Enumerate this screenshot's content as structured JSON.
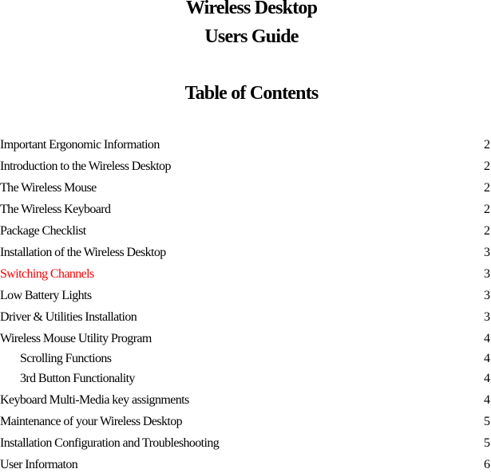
{
  "document": {
    "title_line_1": "Wireless Desktop",
    "title_line_2": "Users Guide",
    "toc_heading": "Table of Contents"
  },
  "highlight_color": "#ff0000",
  "toc": [
    {
      "label": "Important Ergonomic Information",
      "page": "2",
      "indent": false,
      "highlight": false
    },
    {
      "label": "Introduction to the Wireless Desktop",
      "page": "2",
      "indent": false,
      "highlight": false
    },
    {
      "label": "The Wireless Mouse",
      "page": "2",
      "indent": false,
      "highlight": false
    },
    {
      "label": "The Wireless Keyboard",
      "page": "2",
      "indent": false,
      "highlight": false
    },
    {
      "label": "Package Checklist",
      "page": "2",
      "indent": false,
      "highlight": false
    },
    {
      "label": "Installation of the Wireless Desktop",
      "page": "3",
      "indent": false,
      "highlight": false
    },
    {
      "label": "Switching Channels",
      "page": "3",
      "indent": false,
      "highlight": true
    },
    {
      "label": "Low Battery Lights",
      "page": "3",
      "indent": false,
      "highlight": false
    },
    {
      "label": "Driver & Utilities Installation",
      "page": "3",
      "indent": false,
      "highlight": false
    },
    {
      "label": "Wireless Mouse Utility Program",
      "page": "4",
      "indent": false,
      "highlight": false
    },
    {
      "label": "Scrolling Functions",
      "page": "4",
      "indent": true,
      "highlight": false
    },
    {
      "label": "3rd Button Functionality",
      "page": "4",
      "indent": true,
      "highlight": false
    },
    {
      "label": "Keyboard Multi-Media key assignments",
      "page": "4",
      "indent": false,
      "highlight": false
    },
    {
      "label": "Maintenance of your Wireless Desktop",
      "page": "5",
      "indent": false,
      "highlight": false
    },
    {
      "label": "Installation Configuration and Troubleshooting",
      "page": "5",
      "indent": false,
      "highlight": false
    },
    {
      "label": "User Informaton",
      "page": "6",
      "indent": false,
      "highlight": false
    }
  ]
}
